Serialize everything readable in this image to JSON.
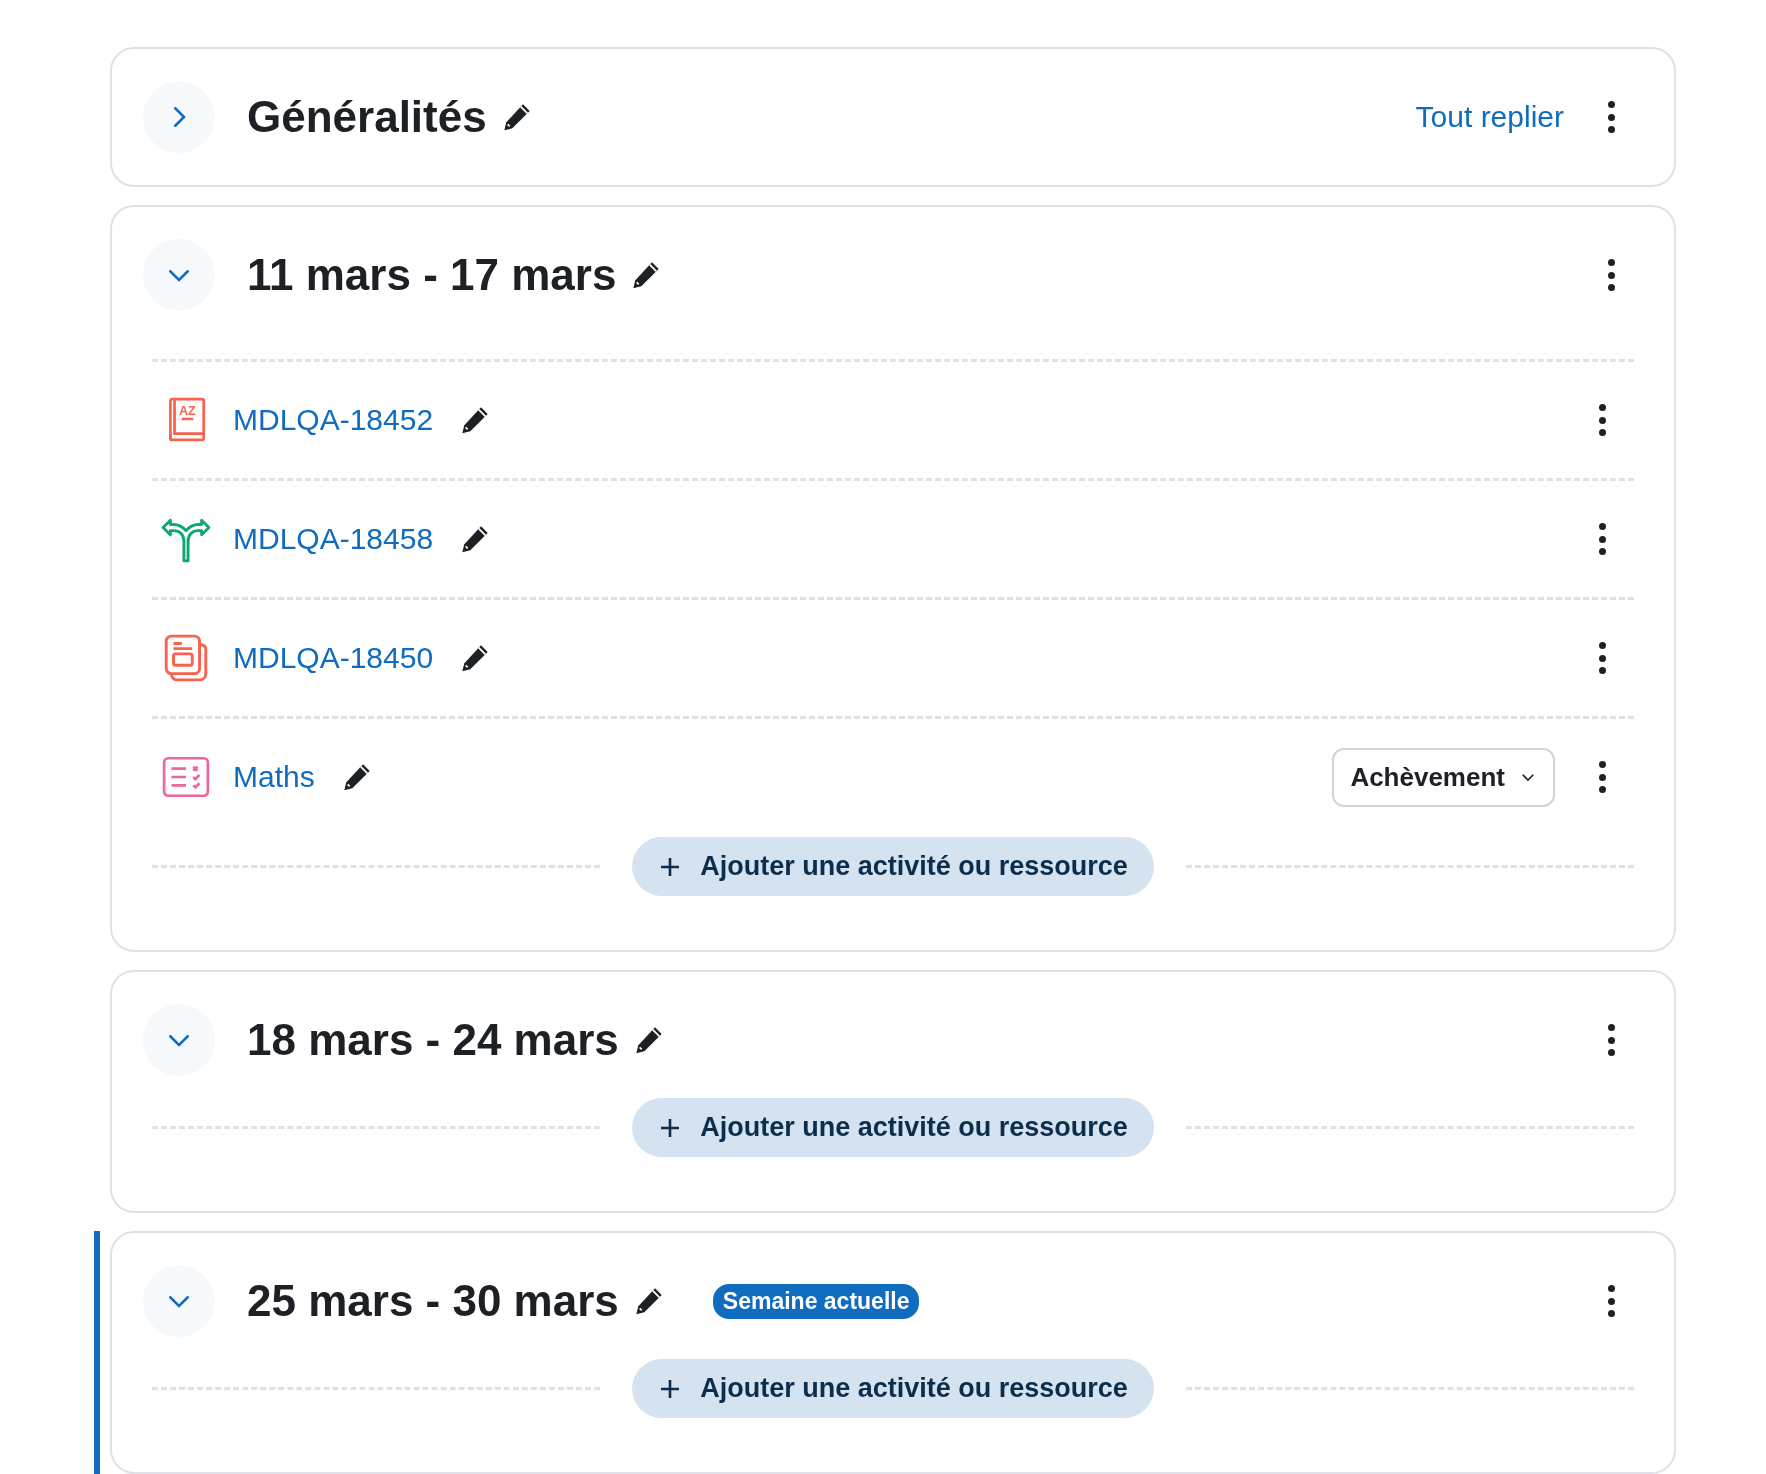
{
  "sections": [
    {
      "title": "Généralités",
      "expanded": false,
      "current": false,
      "header_link": "Tout replier"
    },
    {
      "title": "11 mars - 17 mars",
      "expanded": true,
      "current": false,
      "activities": [
        {
          "kind": "glossary",
          "name": "MDLQA-18452",
          "icon_text": "AZ"
        },
        {
          "kind": "choice",
          "name": "MDLQA-18458"
        },
        {
          "kind": "book",
          "name": "MDLQA-18450"
        },
        {
          "kind": "quiz",
          "name": "Maths",
          "completion": "Achèvement"
        }
      ],
      "add_button": "Ajouter une activité ou ressource"
    },
    {
      "title": "18 mars - 24 mars",
      "expanded": true,
      "current": false,
      "add_button": "Ajouter une activité ou ressource"
    },
    {
      "title": "25 mars - 30 mars",
      "expanded": true,
      "current": true,
      "badge": "Semaine actuelle",
      "add_button": "Ajouter une activité ou ressource"
    }
  ]
}
